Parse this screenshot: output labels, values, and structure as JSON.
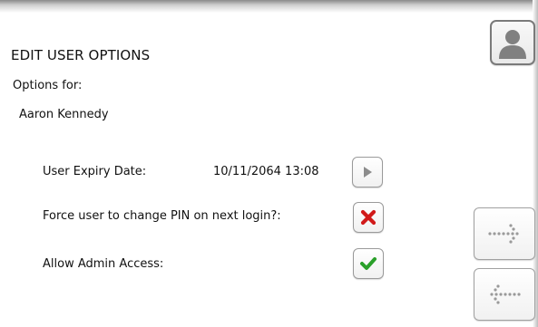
{
  "header": {
    "title": "EDIT USER OPTIONS",
    "options_for_label": "Options for:",
    "user_name": "Aaron Kennedy"
  },
  "rows": {
    "expiry": {
      "label": "User Expiry Date:",
      "value": "10/11/2064 13:08"
    },
    "force_pin": {
      "label": "Force user to change PIN on next login?:"
    },
    "admin": {
      "label": "Allow Admin Access:"
    }
  },
  "icons": {
    "avatar": "user-avatar-icon",
    "expiry_action": "play-arrow-icon",
    "force_pin_state": "red-x-icon",
    "admin_state": "green-check-icon",
    "next": "dotted-arrow-right-icon",
    "back": "dotted-arrow-left-icon"
  },
  "colors": {
    "cross": "#d11a1a",
    "check": "#2aa02a"
  }
}
